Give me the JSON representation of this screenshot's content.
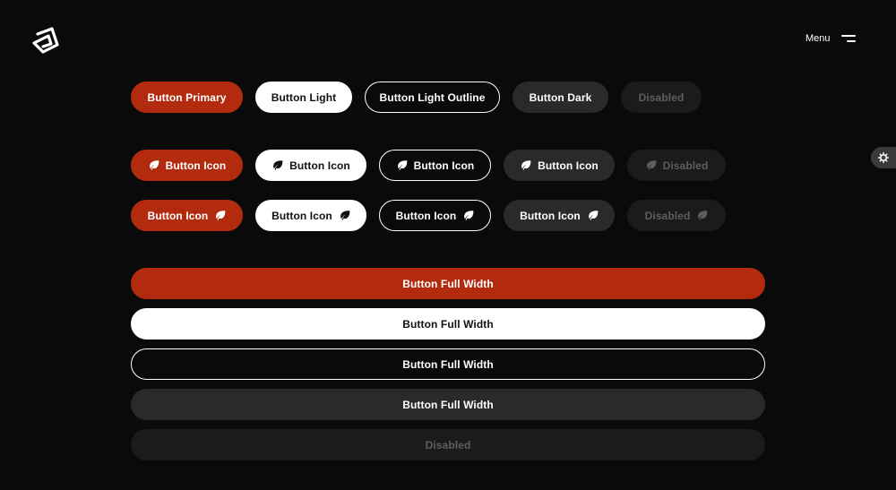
{
  "header": {
    "menu_label": "Menu"
  },
  "icons": {
    "logo": "logo-mark",
    "menu": "hamburger-icon",
    "settings": "gear-icon",
    "leaf": "leaf-icon"
  },
  "colors": {
    "background": "#0a0a0a",
    "primary": "#b32b0f",
    "light": "#ffffff",
    "dark": "#2a2a2a",
    "disabled_bg": "#1b1b1b",
    "disabled_text": "#5e5e5e"
  },
  "row1": {
    "primary": "Button Primary",
    "light": "Button Light",
    "outline": "Button Light Outline",
    "dark": "Button Dark",
    "disabled": "Disabled"
  },
  "row2": {
    "primary": "Button Icon",
    "light": "Button Icon",
    "outline": "Button Icon",
    "dark": "Button Icon",
    "disabled": "Disabled"
  },
  "row3": {
    "primary": "Button Icon",
    "light": "Button Icon",
    "outline": "Button Icon",
    "dark": "Button Icon",
    "disabled": "Disabled"
  },
  "full": {
    "primary": "Button Full Width",
    "light": "Button Full Width",
    "outline": "Button Full Width",
    "dark": "Button Full Width",
    "disabled": "Disabled"
  }
}
